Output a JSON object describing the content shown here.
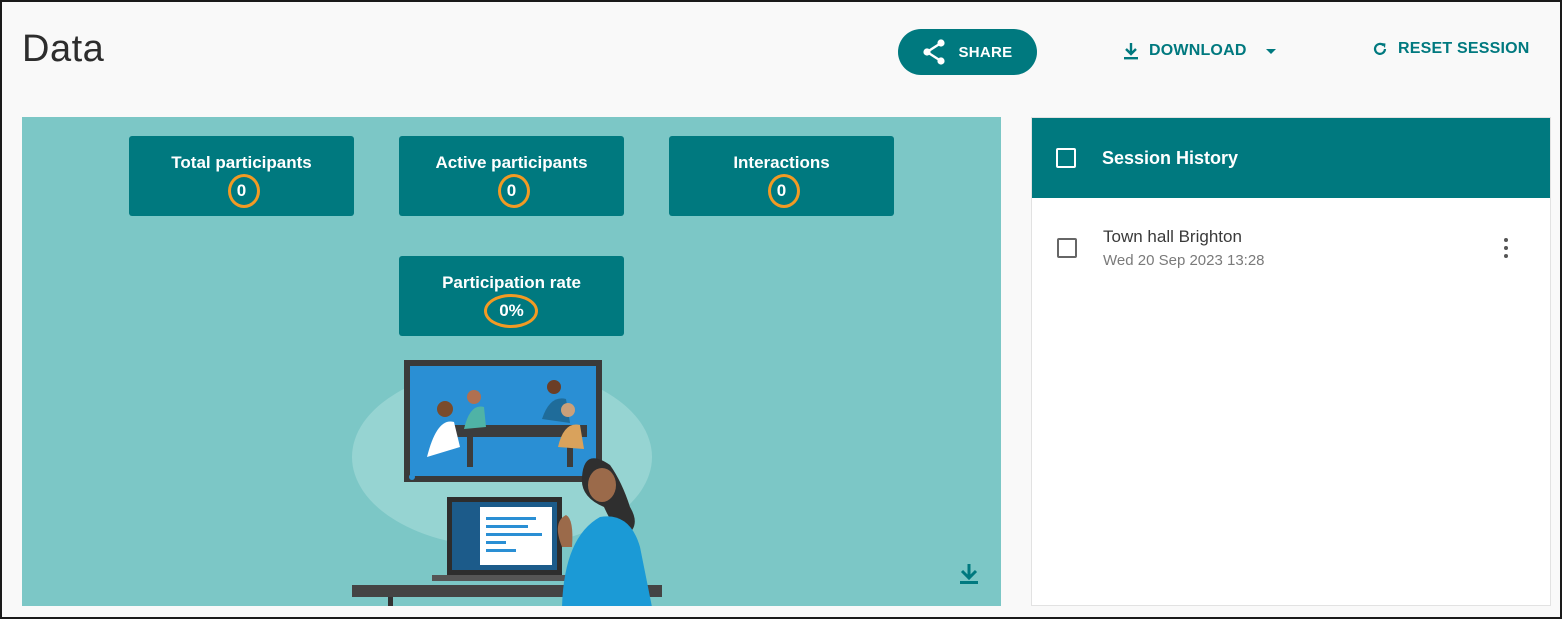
{
  "page": {
    "title": "Data"
  },
  "header": {
    "share_label": "SHARE",
    "download_label": "DOWNLOAD",
    "reset_label": "RESET SESSION"
  },
  "stats": {
    "total_participants": {
      "label": "Total participants",
      "value": "0"
    },
    "active_participants": {
      "label": "Active participants",
      "value": "0"
    },
    "interactions": {
      "label": "Interactions",
      "value": "0"
    },
    "participation_rate": {
      "label": "Participation rate",
      "value": "0%"
    }
  },
  "session_history": {
    "title": "Session History",
    "items": [
      {
        "name": "Town hall Brighton",
        "timestamp": "Wed 20 Sep 2023 13:28"
      }
    ]
  },
  "colors": {
    "accent": "#00797f",
    "panel_bg": "#7cc7c6",
    "highlight_ring": "#f39a23"
  },
  "icons": {
    "share": "share-icon",
    "download": "download-icon",
    "dropdown": "caret-down-icon",
    "reset": "refresh-icon",
    "more": "more-vertical-icon"
  }
}
